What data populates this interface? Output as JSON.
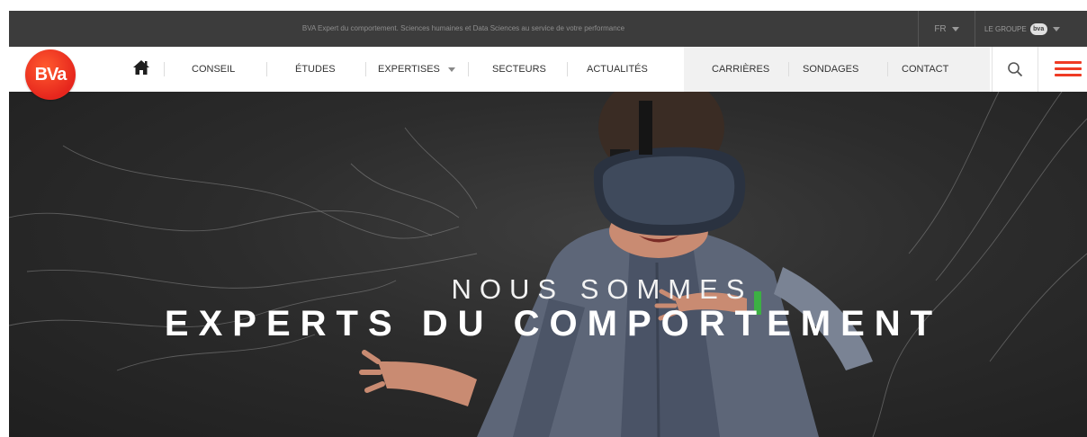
{
  "topbar": {
    "tagline": "BVA Expert du comportement. Sciences humaines et Data Sciences au service de votre performance",
    "language": "FR",
    "group_label": "LE GROUPE",
    "group_logo": "bva"
  },
  "logo": {
    "text": "BVa",
    "color": "#e6261d"
  },
  "nav": {
    "home_icon": "home-icon",
    "items": [
      "CONSEIL",
      "ÉTUDES",
      "EXPERTISES",
      "SECTEURS",
      "ACTUALITÉS",
      "CARRIÈRES",
      "SONDAGES",
      "CONTACT"
    ],
    "search_icon": "search-icon",
    "menu_icon": "hamburger-icon",
    "accent": "#ef3b24"
  },
  "hero": {
    "line1": "NOUS SOMMES",
    "line2": "EXPERTS DU COMPORTEMENT"
  }
}
